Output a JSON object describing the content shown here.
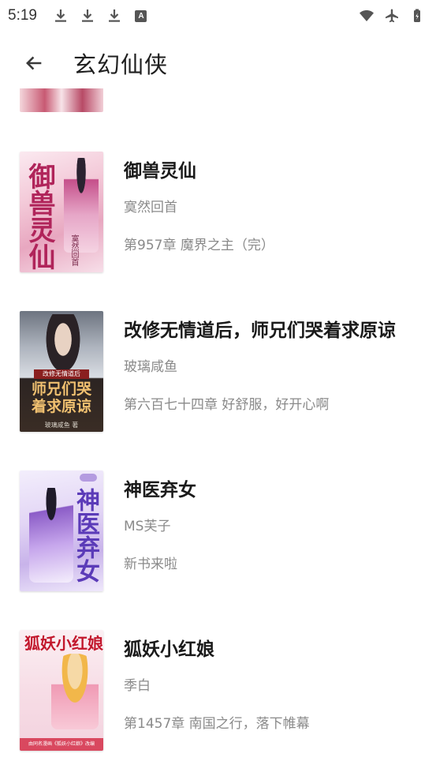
{
  "status_bar": {
    "time": "5:19",
    "left_icons": [
      "download-icon",
      "download-icon",
      "download-icon",
      "a-badge-icon"
    ],
    "right_icons": [
      "wifi-icon",
      "airplane-icon",
      "battery-icon"
    ],
    "badge_letter": "A"
  },
  "app_bar": {
    "title": "玄幻仙侠",
    "back_icon": "arrow-left-icon"
  },
  "books": [
    {
      "title": "御兽灵仙",
      "author": "寞然回首",
      "latest_chapter": "第957章 魔界之主（完）",
      "cover_title": "御兽灵仙",
      "cover_author": "寞然回首"
    },
    {
      "title": "改修无情道后，师兄们哭着求原谅",
      "author": "玻璃咸鱼",
      "latest_chapter": "第六百七十四章 好舒服，好开心啊",
      "cover_banner": "改修无情道后",
      "cover_title": "师兄们哭着求原谅",
      "cover_author": "玻璃咸鱼 著"
    },
    {
      "title": "神医弃女",
      "author": "MS芙子",
      "latest_chapter": "新书来啦",
      "cover_title": "神医弃女"
    },
    {
      "title": "狐妖小红娘",
      "author": "季白",
      "latest_chapter": "第1457章 南国之行，落下帷幕",
      "cover_title": "狐妖小红娘",
      "cover_footer": "由同名漫画《狐妖小红娘》改编"
    }
  ],
  "colors": {
    "title": "#1a1a1a",
    "secondary_text": "#8a8a8a",
    "background": "#ffffff"
  }
}
